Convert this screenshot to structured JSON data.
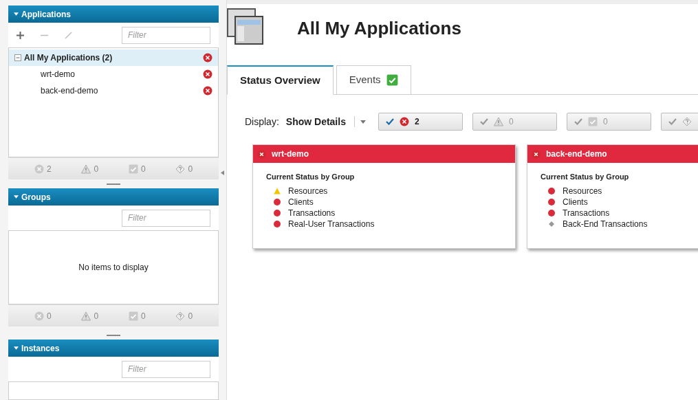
{
  "sidebar": {
    "applications": {
      "title": "Applications",
      "expanded": true,
      "filter_placeholder": "Filter",
      "tree": [
        {
          "label": "All My Applications (2)",
          "expanded": true,
          "selected": true,
          "kind": "critical",
          "children": [
            {
              "label": "wrt-demo",
              "selected": false,
              "kind": "critical"
            },
            {
              "label": "back-end-demo",
              "selected": false,
              "kind": "critical"
            }
          ]
        }
      ],
      "summary": [
        {
          "kind": "critical",
          "count": "2"
        },
        {
          "kind": "warning",
          "count": "0"
        },
        {
          "kind": "normal",
          "count": "0"
        },
        {
          "kind": "unknown",
          "count": "0"
        }
      ]
    },
    "groups": {
      "title": "Groups",
      "expanded": true,
      "filter_placeholder": "Filter",
      "empty_message": "No items to display",
      "summary": [
        {
          "kind": "critical",
          "count": "0"
        },
        {
          "kind": "warning",
          "count": "0"
        },
        {
          "kind": "normal",
          "count": "0"
        },
        {
          "kind": "unknown",
          "count": "0"
        }
      ]
    },
    "instances": {
      "title": "Instances",
      "expanded": true,
      "filter_placeholder": "Filter"
    }
  },
  "page": {
    "title": "All My Applications",
    "tabs": [
      {
        "label": "Status Overview",
        "selected": true
      },
      {
        "label": "Events",
        "selected": false,
        "kind": "normal"
      }
    ],
    "display": {
      "label": "Display:",
      "value": "Show Details"
    },
    "status_filters": [
      {
        "kind": "critical",
        "checked": true,
        "count": "2"
      },
      {
        "kind": "warning",
        "checked": false,
        "count": "0"
      },
      {
        "kind": "normal",
        "checked": false,
        "count": "0"
      },
      {
        "kind": "unknown",
        "checked": false
      }
    ],
    "cards": [
      {
        "title": "wrt-demo",
        "kind": "critical",
        "heading": "Current Status by Group",
        "groups": [
          {
            "label": "Resources",
            "kind": "warning"
          },
          {
            "label": "Clients",
            "kind": "critical"
          },
          {
            "label": "Transactions",
            "kind": "critical"
          },
          {
            "label": "Real-User Transactions",
            "kind": "critical"
          }
        ]
      },
      {
        "title": "back-end-demo",
        "kind": "critical",
        "heading": "Current Status by Group",
        "groups": [
          {
            "label": "Resources",
            "kind": "critical"
          },
          {
            "label": "Clients",
            "kind": "critical"
          },
          {
            "label": "Transactions",
            "kind": "critical"
          },
          {
            "label": "Back-End Transactions",
            "kind": "unknown"
          }
        ]
      }
    ]
  }
}
